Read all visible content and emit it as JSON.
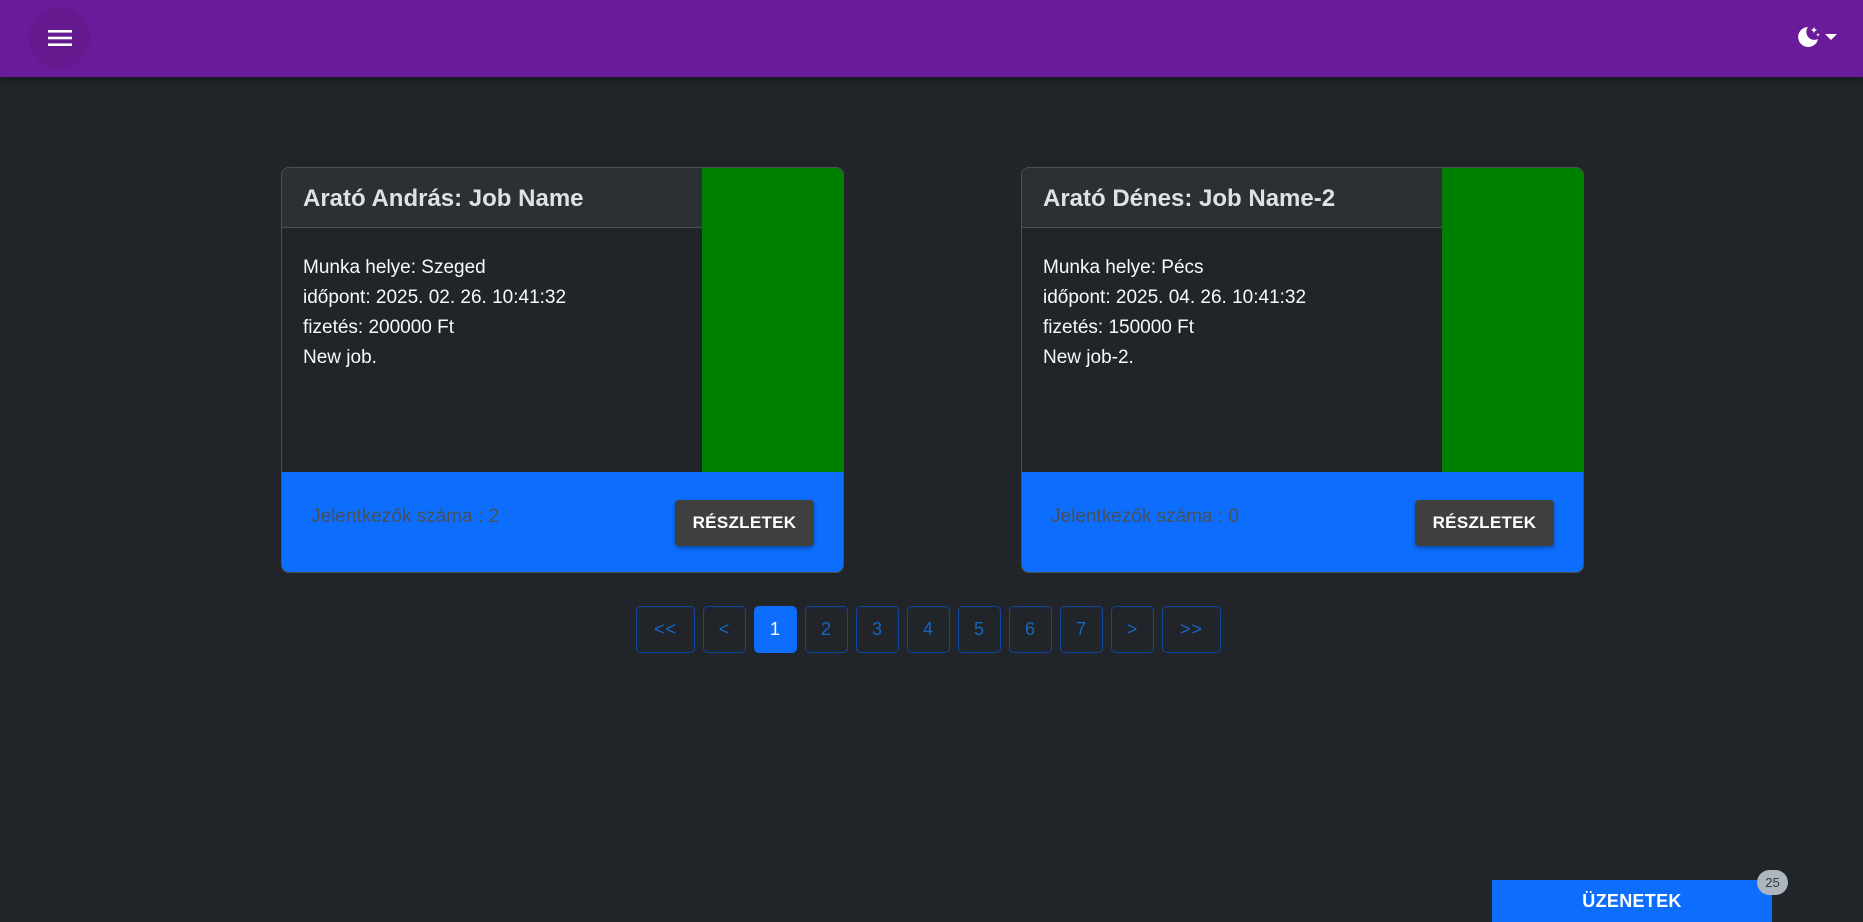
{
  "topbar": {
    "menu_icon": "hamburger-menu-icon",
    "theme_icon": "moon-stars-icon",
    "theme_caret_icon": "caret-down-icon",
    "color": "#6a1b9a"
  },
  "jobs": [
    {
      "title": "Arató András: Job Name",
      "location": "Munka helye: Szeged",
      "time": "időpont: 2025. 02. 26. 10:41:32",
      "salary": "fizetés: 200000 Ft",
      "description": "New job.",
      "applicants": "Jelentkezők száma : 2",
      "details_label": "RÉSZLETEK"
    },
    {
      "title": "Arató Dénes: Job Name-2",
      "location": "Munka helye: Pécs",
      "time": "időpont: 2025. 04. 26. 10:41:32",
      "salary": "fizetés: 150000 Ft",
      "description": "New job-2.",
      "applicants": "Jelentkezők száma : 0",
      "details_label": "RÉSZLETEK"
    }
  ],
  "pagination": {
    "first": "<<",
    "prev": "<",
    "pages": [
      "1",
      "2",
      "3",
      "4",
      "5",
      "6",
      "7"
    ],
    "active_page": "1",
    "next": ">",
    "last": ">>"
  },
  "messages": {
    "label": "ÜZENETEK",
    "count": "25"
  },
  "colors": {
    "background": "#212529",
    "accent_blue": "#0d6efd",
    "card_green": "#008000"
  }
}
